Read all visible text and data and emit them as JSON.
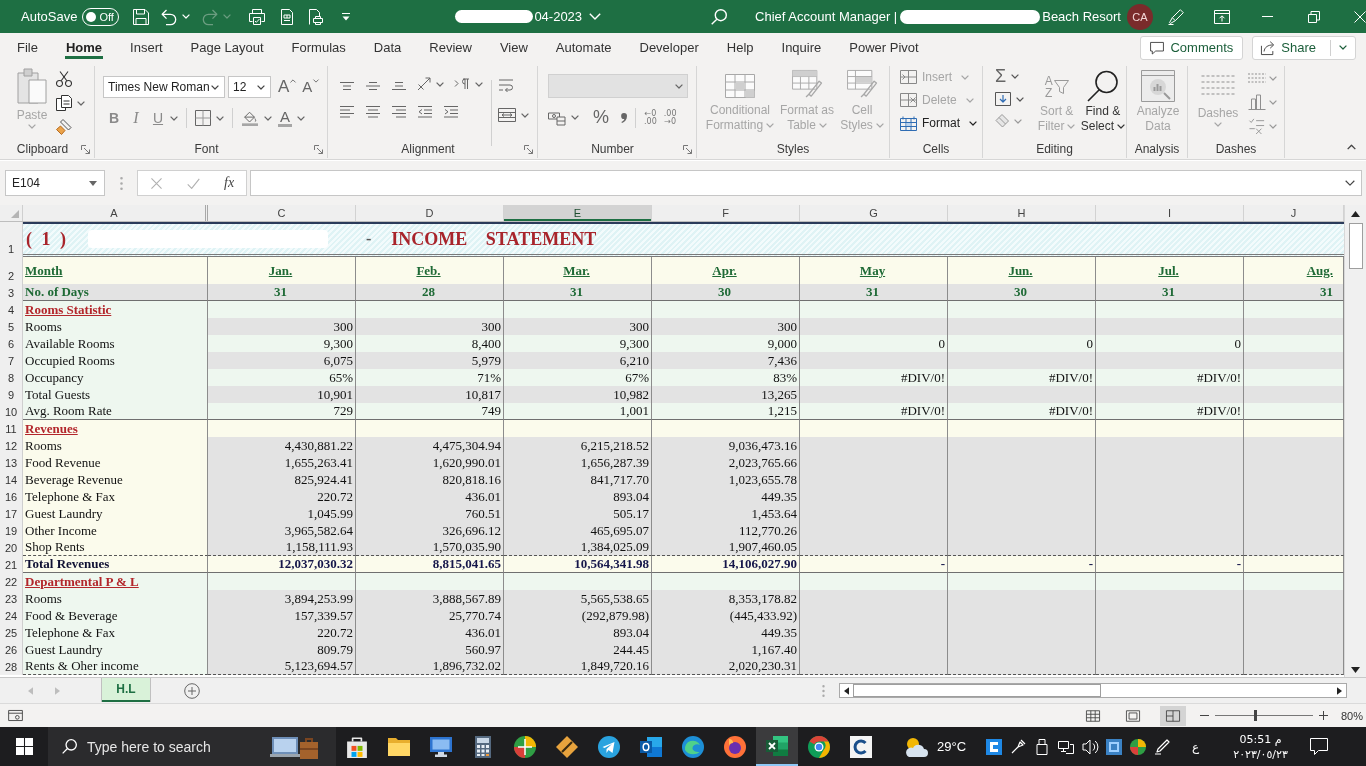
{
  "title_bar": {
    "autosave": {
      "label": "AutoSave",
      "state_label": "Off",
      "on": false
    },
    "file_name": "04-2023",
    "account_title": "Chief Account Manager |",
    "account_suffix": "Beach Resort",
    "avatar": "CA"
  },
  "ribbon_tabs": [
    {
      "label": "File",
      "selected": false
    },
    {
      "label": "Home",
      "selected": true
    },
    {
      "label": "Insert",
      "selected": false
    },
    {
      "label": "Page Layout",
      "selected": false
    },
    {
      "label": "Formulas",
      "selected": false
    },
    {
      "label": "Data",
      "selected": false
    },
    {
      "label": "Review",
      "selected": false
    },
    {
      "label": "View",
      "selected": false
    },
    {
      "label": "Automate",
      "selected": false
    },
    {
      "label": "Developer",
      "selected": false
    },
    {
      "label": "Help",
      "selected": false
    },
    {
      "label": "Inquire",
      "selected": false
    },
    {
      "label": "Power Pivot",
      "selected": false
    }
  ],
  "ribbon_actions": {
    "comments": "Comments",
    "share": "Share"
  },
  "ribbon": {
    "clipboard": {
      "label": "Clipboard",
      "paste": {
        "label": "Paste",
        "disabled": true
      }
    },
    "font": {
      "label": "Font",
      "font_name": "Times New Roman",
      "font_size": "12",
      "size_glyphs": [
        "A",
        "A"
      ],
      "style_glyphs": [
        "B",
        "I",
        "U"
      ],
      "color_glyph": "A"
    },
    "alignment": {
      "label": "Alignment"
    },
    "number": {
      "label": "Number",
      "percent": "%",
      "decimal_buttons": [
        {
          "top": "←0",
          "bottom": ".00"
        },
        {
          "top": ".00",
          "bottom": "→0"
        }
      ]
    },
    "styles": {
      "label": "Styles",
      "buttons": [
        {
          "kind": "conditional",
          "label": "Conditional Formatting",
          "disabled": true
        },
        {
          "kind": "table",
          "label": "Format as Table",
          "disabled": true
        },
        {
          "kind": "cell_styles",
          "label": "Cell Styles",
          "disabled": true
        }
      ]
    },
    "cells": {
      "label": "Cells",
      "buttons": [
        {
          "kind": "insert",
          "label": "Insert",
          "disabled": true
        },
        {
          "kind": "delete",
          "label": "Delete",
          "disabled": true
        },
        {
          "kind": "format",
          "label": "Format",
          "disabled": false
        }
      ]
    },
    "editing": {
      "label": "Editing",
      "sum_glyph": "Σ",
      "sort_glyphs": [
        "A",
        "Z"
      ],
      "buttons": [
        {
          "kind": "sort",
          "label": "Sort & Filter",
          "disabled": true
        },
        {
          "kind": "find",
          "label": "Find & Select",
          "disabled": false
        }
      ]
    },
    "analysis": {
      "label": "Analysis",
      "button": {
        "label": "Analyze Data",
        "disabled": true
      }
    },
    "dashes": {
      "label": "Dashes",
      "button": {
        "label": "Dashes",
        "disabled": true
      }
    }
  },
  "formula_bar": {
    "name_box": "E104",
    "function_glyph": "fx"
  },
  "sheet": {
    "columns": [
      {
        "label": "A",
        "selected": false
      },
      {
        "label": "C",
        "selected": false
      },
      {
        "label": "D",
        "selected": false
      },
      {
        "label": "E",
        "selected": true
      },
      {
        "label": "F",
        "selected": false
      },
      {
        "label": "G",
        "selected": false
      },
      {
        "label": "H",
        "selected": false
      },
      {
        "label": "I",
        "selected": false
      },
      {
        "label": "J",
        "selected": false
      }
    ],
    "title_row": {
      "number": "1",
      "prefix": "( 1 )",
      "separator": "-",
      "title": "INCOME STATEMENT"
    },
    "rows": [
      {
        "number": "2",
        "kind": "month",
        "label": "Month",
        "cells": [
          "Jan.",
          "Feb.",
          "Mar.",
          "Apr.",
          "May",
          "Jun.",
          "Jul.",
          "Aug."
        ]
      },
      {
        "number": "3",
        "kind": "days",
        "label": "No. of Days",
        "cells": [
          "31",
          "28",
          "31",
          "30",
          "31",
          "30",
          "31",
          "31"
        ]
      },
      {
        "number": "4",
        "kind": "section",
        "label": "Rooms Statistic"
      },
      {
        "number": "5",
        "kind": "item",
        "label": "Rooms",
        "cells": [
          "300",
          "300",
          "300",
          "300",
          null,
          null,
          null,
          null
        ]
      },
      {
        "number": "6",
        "kind": "item",
        "label": "Available Rooms",
        "cells": [
          "9,300",
          "8,400",
          "9,300",
          "9,000",
          "0",
          "0",
          "0",
          null
        ]
      },
      {
        "number": "7",
        "kind": "item",
        "label": "Occupied Rooms",
        "cells": [
          "6,075",
          "5,979",
          "6,210",
          "7,436",
          null,
          null,
          null,
          null
        ]
      },
      {
        "number": "8",
        "kind": "item",
        "label": "Occupancy",
        "cells": [
          "65%",
          "71%",
          "67%",
          "83%",
          "#DIV/0!",
          "#DIV/0!",
          "#DIV/0!",
          null
        ]
      },
      {
        "number": "9",
        "kind": "item",
        "label": "Total Guests",
        "cells": [
          "10,901",
          "10,817",
          "10,982",
          "13,265",
          null,
          null,
          null,
          null
        ]
      },
      {
        "number": "10",
        "kind": "item",
        "label": "Avg. Room Rate",
        "cells": [
          "729",
          "749",
          "1,001",
          "1,215",
          "#DIV/0!",
          "#DIV/0!",
          "#DIV/0!",
          null
        ]
      },
      {
        "number": "11",
        "kind": "section",
        "label": "Revenues"
      },
      {
        "number": "12",
        "kind": "item",
        "label": "Rooms",
        "cells": [
          "4,430,881.22",
          "4,475,304.94",
          "6,215,218.52",
          "9,036,473.16",
          null,
          null,
          null,
          null
        ]
      },
      {
        "number": "13",
        "kind": "item",
        "label": "Food Revenue",
        "cells": [
          "1,655,263.41",
          "1,620,990.01",
          "1,656,287.39",
          "2,023,765.66",
          null,
          null,
          null,
          null
        ]
      },
      {
        "number": "14",
        "kind": "item",
        "label": "Beverage Revenue",
        "cells": [
          "825,924.41",
          "820,818.16",
          "841,717.70",
          "1,023,655.78",
          null,
          null,
          null,
          null
        ]
      },
      {
        "number": "16",
        "kind": "item",
        "label": "Telephone & Fax",
        "cells": [
          "220.72",
          "436.01",
          "893.04",
          "449.35",
          null,
          null,
          null,
          null
        ]
      },
      {
        "number": "17",
        "kind": "item",
        "label": "Guest Laundry",
        "cells": [
          "1,045.99",
          "760.51",
          "505.17",
          "1,453.64",
          null,
          null,
          null,
          null
        ]
      },
      {
        "number": "19",
        "kind": "item",
        "label": "Other Income",
        "cells": [
          "3,965,582.64",
          "326,696.12",
          "465,695.07",
          "112,770.26",
          null,
          null,
          null,
          null
        ]
      },
      {
        "number": "20",
        "kind": "item",
        "label": "Shop Rents",
        "cells": [
          "1,158,111.93",
          "1,570,035.90",
          "1,384,025.09",
          "1,907,460.05",
          null,
          null,
          null,
          null
        ]
      },
      {
        "number": "21",
        "kind": "total",
        "label": "Total Revenues",
        "cells": [
          "12,037,030.32",
          "8,815,041.65",
          "10,564,341.98",
          "14,106,027.90",
          "-",
          "-",
          "-",
          null
        ]
      },
      {
        "number": "22",
        "kind": "section",
        "label": "Departmental P & L"
      },
      {
        "number": "23",
        "kind": "item",
        "label": "Rooms",
        "cells": [
          "3,894,253.99",
          "3,888,567.89",
          "5,565,538.65",
          "8,353,178.82",
          null,
          null,
          null,
          null
        ]
      },
      {
        "number": "24",
        "kind": "item",
        "label": "Food & Beverage",
        "cells": [
          "157,339.57",
          "25,770.74",
          "(292,879.98)",
          "(445,433.92)",
          null,
          null,
          null,
          null
        ]
      },
      {
        "number": "25",
        "kind": "item",
        "label": "Telephone & Fax",
        "cells": [
          "220.72",
          "436.01",
          "893.04",
          "449.35",
          null,
          null,
          null,
          null
        ]
      },
      {
        "number": "26",
        "kind": "item",
        "label": "Guest Laundry",
        "cells": [
          "809.79",
          "560.97",
          "244.45",
          "1,167.40",
          null,
          null,
          null,
          null
        ]
      },
      {
        "number": "28",
        "kind": "item",
        "label": "Rents & Oher income",
        "cells": [
          "5,123,694.57",
          "1,896,732.02",
          "1,849,720.16",
          "2,020,230.31",
          null,
          null,
          null,
          null
        ]
      }
    ]
  },
  "sheet_tabs": [
    {
      "label": "H.L",
      "selected": true
    }
  ],
  "status_bar": {
    "views": [
      {
        "kind": "normal",
        "selected": false
      },
      {
        "kind": "page_layout",
        "selected": false
      },
      {
        "kind": "page_break",
        "selected": true
      }
    ],
    "zoom": {
      "level": 0.41,
      "label": "80%"
    }
  },
  "taskbar": {
    "search_placeholder": "Type here to search",
    "apps": [
      {
        "kind": "store",
        "active": false
      },
      {
        "kind": "folder",
        "active": false
      },
      {
        "kind": "monitor",
        "active": false
      },
      {
        "kind": "calculator",
        "active": false
      },
      {
        "kind": "globe",
        "active": false
      },
      {
        "kind": "diamond",
        "active": false
      },
      {
        "kind": "telegram",
        "active": false
      },
      {
        "kind": "outlook",
        "active": false
      },
      {
        "kind": "browser",
        "active": false
      },
      {
        "kind": "firefox",
        "active": false
      },
      {
        "kind": "excel",
        "active": true
      },
      {
        "kind": "chrome",
        "active": false
      },
      {
        "kind": "ring",
        "active": false
      }
    ],
    "weather": "29°C",
    "input_language": "ع",
    "time": "05:51 م",
    "date": "٢٠٢٣/٠٥/٢٣"
  }
}
